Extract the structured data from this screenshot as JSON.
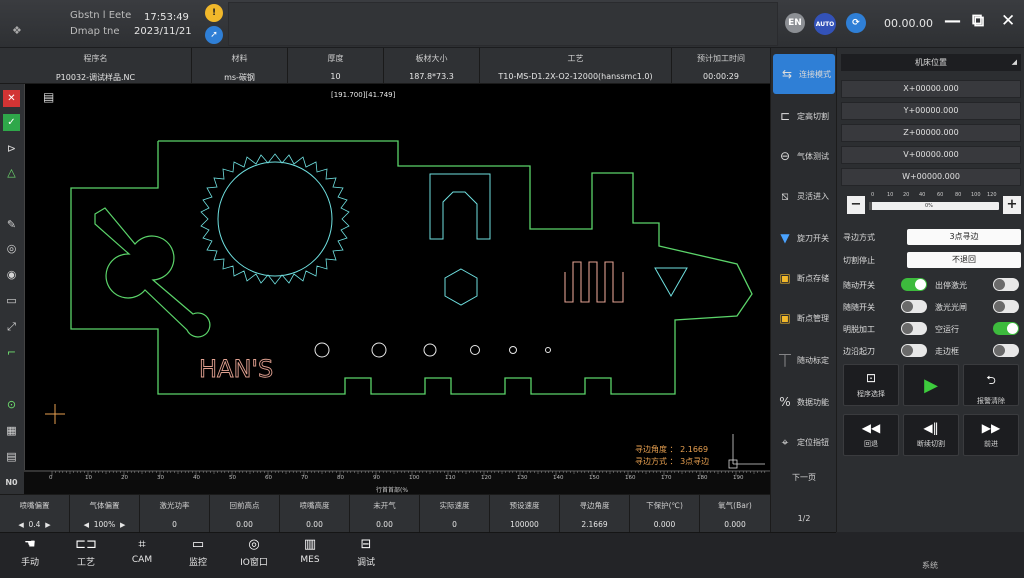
{
  "topbar": {
    "blurred_line1": "Gbstn l Eete",
    "blurred_line2": "Dmap  tne",
    "time": "17:53:49",
    "date": "2023/11/21",
    "lang_badge": "EN",
    "auto_badge": "AUTO",
    "timer": "00.00.00",
    "minimize_glyph": "—",
    "restore_glyph": "⧉",
    "close_glyph": "✕"
  },
  "header": {
    "columns": [
      {
        "label": "程序名",
        "value": "P10032-调试样品.NC"
      },
      {
        "label": "材料",
        "value": "ms-碳钢"
      },
      {
        "label": "厚度",
        "value": "10"
      },
      {
        "label": "板材大小",
        "value": "187.8*73.3"
      },
      {
        "label": "工艺",
        "value": "T10-MS-D1.2X-O2-12000(hanssmc1.0)"
      },
      {
        "label": "预计加工时间",
        "value": "00:00:29"
      }
    ]
  },
  "canvas": {
    "coords": "[191.700][41.749]",
    "edge_angle_label": "寻边角度 ：",
    "edge_angle_value": "2.1669",
    "edge_mode_label": "寻边方式 ：",
    "edge_mode_value": "3点寻边",
    "ruler_caption": "行首首部(%",
    "ruler_numbers": [
      "0",
      "10",
      "20",
      "30",
      "40",
      "50",
      "60",
      "70",
      "80",
      "90",
      "100",
      "110",
      "120",
      "130",
      "140",
      "150",
      "160",
      "170",
      "180",
      "190"
    ]
  },
  "modes": [
    {
      "label": "连接模式",
      "icon": "link-icon",
      "active": true
    },
    {
      "label": "定高切割",
      "icon": "height-cut-icon",
      "active": false
    },
    {
      "label": "气体测试",
      "icon": "gas-test-icon",
      "active": false
    },
    {
      "label": "灵活进入",
      "icon": "flex-enter-icon",
      "active": false
    },
    {
      "label": "旋刀开关",
      "icon": "knife-switch-icon",
      "active": false
    },
    {
      "label": "断点存储",
      "icon": "breakpoint-save-icon",
      "active": false
    },
    {
      "label": "断点管理",
      "icon": "breakpoint-manage-icon",
      "active": false
    },
    {
      "label": "随动标定",
      "icon": "calibrate-icon",
      "active": false
    },
    {
      "label": "数据功能",
      "icon": "data-function-icon",
      "active": false
    },
    {
      "label": "定位指钮",
      "icon": "locate-icon",
      "active": false
    },
    {
      "label": "下一页",
      "icon": "",
      "active": false
    },
    {
      "label": "1/2",
      "icon": "",
      "active": false
    }
  ],
  "rpanel": {
    "machine_pos": "机床位置",
    "axes": [
      "X+00000.000",
      "Y+00000.000",
      "Z+00000.000",
      "V+00000.000",
      "W+00000.000"
    ],
    "slider_ticks": [
      "0",
      "10",
      "20",
      "40",
      "60",
      "80",
      "100",
      "120"
    ],
    "slider_value": "0%",
    "slider_level": 0,
    "minus_label": "−",
    "plus_label": "+",
    "edge_mode_label": "寻边方式",
    "edge_mode_value": "3点寻边",
    "cut_stop_label": "切割停止",
    "cut_stop_value": "不退回",
    "toggles": [
      {
        "label": "随动开关",
        "on": true
      },
      {
        "label": "出停激光",
        "on": false
      },
      {
        "label": "随随开关",
        "on": false
      },
      {
        "label": "激光光闸",
        "on": false
      },
      {
        "label": "明脱加工",
        "on": false
      },
      {
        "label": "空运行",
        "on": true
      },
      {
        "label": "边沿起刀",
        "on": false
      },
      {
        "label": "走边框",
        "on": false
      }
    ],
    "actions": [
      {
        "label": "程序选择",
        "icon": "program-select-icon"
      },
      {
        "label": "",
        "icon": "play-icon"
      },
      {
        "label": "报警清除",
        "icon": "alarm-clear-icon"
      },
      {
        "label": "回退",
        "icon": "back-icon"
      },
      {
        "label": "断续切割",
        "icon": "pause-icon"
      },
      {
        "label": "前进",
        "icon": "forward-icon"
      }
    ]
  },
  "status": {
    "columns": [
      {
        "label": "喷嘴偏置",
        "value": "0.4"
      },
      {
        "label": "气体偏置",
        "value": "100%"
      },
      {
        "label": "激光功率",
        "value": "0"
      },
      {
        "label": "回前高点",
        "value": "0.00"
      },
      {
        "label": "喷嘴高度",
        "value": "0.00"
      },
      {
        "label": "未开气",
        "value": "0.00"
      },
      {
        "label": "实际速度",
        "value": "0"
      },
      {
        "label": "预设速度",
        "value": "100000"
      },
      {
        "label": "寻边角度",
        "value": "2.1669"
      },
      {
        "label": "下保护(℃)",
        "value": "0.000"
      },
      {
        "label": "氧气(Bar)",
        "value": "0.000"
      }
    ]
  },
  "bottom_nav": [
    {
      "label": "手动",
      "icon": "hand-icon"
    },
    {
      "label": "工艺",
      "icon": "process-icon"
    },
    {
      "label": "CAM",
      "icon": "cam-icon"
    },
    {
      "label": "监控",
      "icon": "monitor-icon"
    },
    {
      "label": "IO窗口",
      "icon": "io-window-icon"
    },
    {
      "label": "MES",
      "icon": "mes-icon"
    },
    {
      "label": "调试",
      "icon": "debug-icon"
    }
  ],
  "bottom_right": "系统",
  "colors": {
    "accent": "#2f7fd6",
    "part_outline": "#5bd46a",
    "gear": "#6fe0e0",
    "logo_text": "#e0a090",
    "toggle_on": "#3dbb3d",
    "edge_text": "#e8a050"
  }
}
